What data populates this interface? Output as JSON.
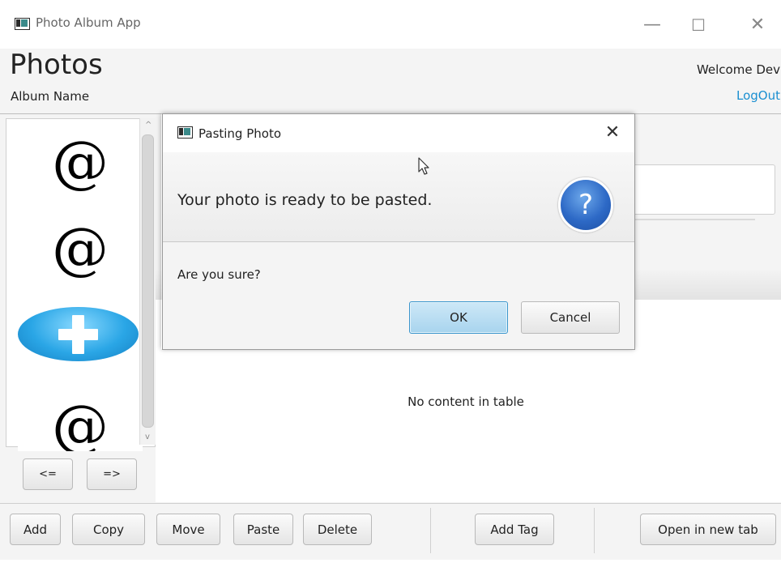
{
  "window": {
    "title": "Photo Album App",
    "controls": {
      "minimize": "—",
      "maximize": "☐",
      "close": "✕"
    }
  },
  "header": {
    "title": "Photos",
    "album_name": "Album Name",
    "welcome": "Welcome Dev",
    "logout": "LogOut"
  },
  "thumbnails": [
    {
      "type": "at-sign",
      "glyph": "@"
    },
    {
      "type": "at-sign",
      "glyph": "@"
    },
    {
      "type": "add",
      "icon": "plus-icon"
    },
    {
      "type": "at-sign",
      "glyph": "@"
    }
  ],
  "scrollbar": {
    "up": "^",
    "down": "v"
  },
  "nav": {
    "prev": "<=",
    "next": "=>"
  },
  "table": {
    "empty_message": "No content in table"
  },
  "toolbar": {
    "add": "Add",
    "copy": "Copy",
    "move": "Move",
    "paste": "Paste",
    "delete": "Delete",
    "add_tag": "Add Tag",
    "open_tab": "Open in new tab"
  },
  "dialog": {
    "title": "Pasting Photo",
    "close": "✕",
    "header_text": "Your photo is ready to be pasted.",
    "icon": "question-icon",
    "icon_glyph": "?",
    "content": "Are you sure?",
    "ok": "OK",
    "cancel": "Cancel"
  },
  "colors": {
    "link": "#1a8fd1",
    "ok_button": "#a8d4ee",
    "question_icon": "#2d69c6",
    "add_thumb": "#2aa6e6"
  }
}
